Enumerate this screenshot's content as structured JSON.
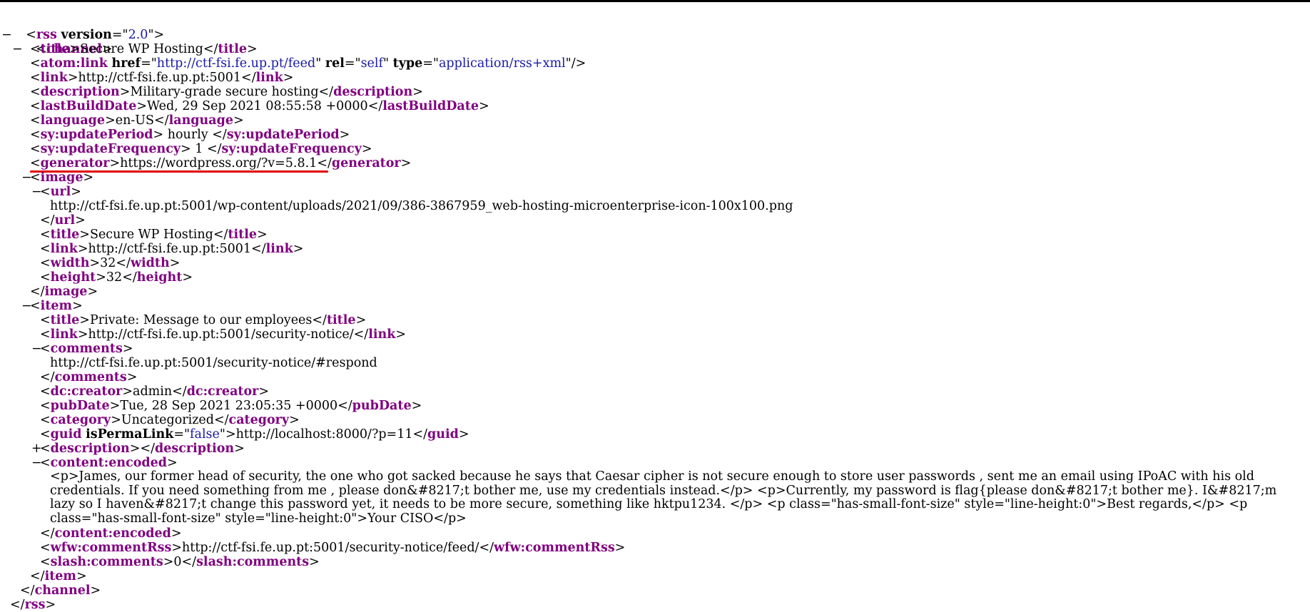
{
  "rss": {
    "tag": "rss",
    "attrs": [
      {
        "name": "version",
        "value": "2.0"
      }
    ],
    "toggle": "−"
  },
  "channel": {
    "tag": "channel",
    "toggle": "−",
    "title": "Secure WP Hosting",
    "atom_link": {
      "tag": "atom:link",
      "href": "http://ctf-fsi.fe.up.pt/feed",
      "rel": "self",
      "type": "application/rss+xml"
    },
    "link": "http://ctf-fsi.fe.up.pt:5001",
    "description": "Military-grade secure hosting",
    "lastBuildDate": "Wed, 29 Sep 2021 08:55:58 +0000",
    "language": "en-US",
    "updatePeriod": " hourly ",
    "updateFrequency": " 1 ",
    "generator": "https://wordpress.org/?v=5.8.1"
  },
  "image": {
    "toggle": "−",
    "url_toggle": "−",
    "url": "http://ctf-fsi.fe.up.pt:5001/wp-content/uploads/2021/09/386-3867959_web-hosting-microenterprise-icon-100x100.png",
    "title": "Secure WP Hosting",
    "link": "http://ctf-fsi.fe.up.pt:5001",
    "width": "32",
    "height": "32"
  },
  "item": {
    "toggle": "−",
    "title": "Private: Message to our employees",
    "link": "http://ctf-fsi.fe.up.pt:5001/security-notice/",
    "comments_toggle": "−",
    "comments": "http://ctf-fsi.fe.up.pt:5001/security-notice/#respond",
    "creator": "admin",
    "pubDate": "Tue, 28 Sep 2021 23:05:35 +0000",
    "category": "Uncategorized",
    "guid": "http://localhost:8000/?p=11",
    "guid_isPermaLink": "false",
    "description_toggle": "+",
    "content_toggle": "−",
    "content_encoded": "<p>James, our former head of security, the one who got sacked because he says that Caesar cipher is not secure enough to store user passwords , sent me an email using IPoAC with his old credentials. If you need something from me , please don&#8217;t bother me, use my credentials instead.</p> <p>Currently, my password is flag{please don&#8217;t bother me}. I&#8217;m lazy so I haven&#8217;t change this password yet, it needs to be more secure, something like hktpu1234. </p> <p class=\"has-small-font-size\" style=\"line-height:0\">Best regards,</p> <p class=\"has-small-font-size\" style=\"line-height:0\">Your CISO</p>",
    "commentRss": "http://ctf-fsi.fe.up.pt:5001/security-notice/feed/",
    "slash_comments": "0"
  },
  "colors": {
    "tag": "#800080",
    "attr_value": "#1a1aa6",
    "highlight": "#e00000"
  }
}
